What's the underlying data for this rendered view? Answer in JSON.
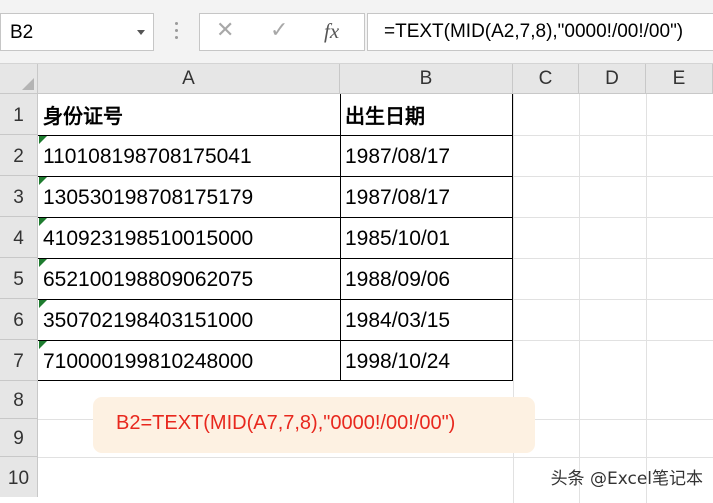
{
  "formula_bar": {
    "name_box": "B2",
    "cancel_icon": "x-icon",
    "enter_icon": "checkmark-icon",
    "fx_label": "fx",
    "formula": "=TEXT(MID(A2,7,8),\"0000!/00!/00\")"
  },
  "columns": [
    "A",
    "B",
    "C",
    "D",
    "E"
  ],
  "rows": [
    "1",
    "2",
    "3",
    "4",
    "5",
    "6",
    "7",
    "8",
    "9",
    "10"
  ],
  "table": {
    "headers": [
      "身份证号",
      "出生日期"
    ],
    "rows": [
      [
        "110108198708175041",
        "1987/08/17"
      ],
      [
        "130530198708175179",
        "1987/08/17"
      ],
      [
        "410923198510015000",
        "1985/10/01"
      ],
      [
        "652100198809062075",
        "1988/09/06"
      ],
      [
        "350702198403151000",
        "1984/03/15"
      ],
      [
        "710000199810248000",
        "1998/10/24"
      ]
    ]
  },
  "callout": {
    "text": "B2=TEXT(MID(A7,7,8),\"0000!/00!/00\")"
  },
  "watermark": "头条 @Excel笔记本",
  "colors": {
    "error_indicator": "#1e7c2f",
    "callout_bg": "#fdf1e2",
    "callout_text": "#e8281e"
  }
}
